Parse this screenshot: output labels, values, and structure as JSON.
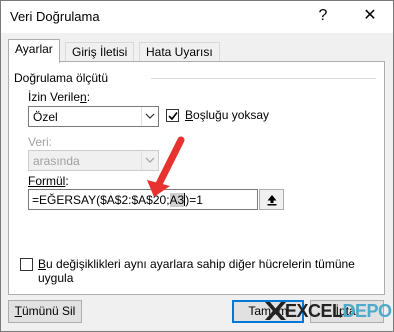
{
  "window": {
    "title": "Veri Doğrulama",
    "help": "?",
    "close": "✕"
  },
  "tabs": [
    {
      "label": "Ayarlar",
      "active": true
    },
    {
      "label": "Giriş İletisi",
      "active": false
    },
    {
      "label": "Hata Uyarısı",
      "active": false
    }
  ],
  "group": {
    "label": "Doğrulama ölçütü"
  },
  "allow": {
    "label_pre": "İzin Verile",
    "label_ul": "n",
    "label_post": ":",
    "value": "Özel"
  },
  "ignore_blank": {
    "label_ul": "B",
    "label_rest": "oşluğu yoksay",
    "checked": true
  },
  "data": {
    "label": "Veri:",
    "value": "arasında",
    "disabled": true
  },
  "formula": {
    "label_pre": "Formül",
    "label_post": ":",
    "text_before": "=EĞERSAY($A$2:$A$20;",
    "text_selected": "A3",
    "text_after": ")=1"
  },
  "apply_all": {
    "label_ul": "B",
    "label_line1": "u değişiklikleri aynı ayarlara sahip diğer hücrelerin tümüne",
    "label_line2": "uygula",
    "checked": false
  },
  "buttons": {
    "clear_all_ul": "T",
    "clear_all_rest": "ümünü Sil",
    "ok": "Tamam",
    "cancel": "İptal"
  },
  "logo": {
    "part1": "EXCEL",
    "part2": "DEPO"
  },
  "colors": {
    "annotation_arrow": "#e8322f",
    "focus_border": "#0078d7",
    "logo_accent": "#4fa9c9"
  }
}
